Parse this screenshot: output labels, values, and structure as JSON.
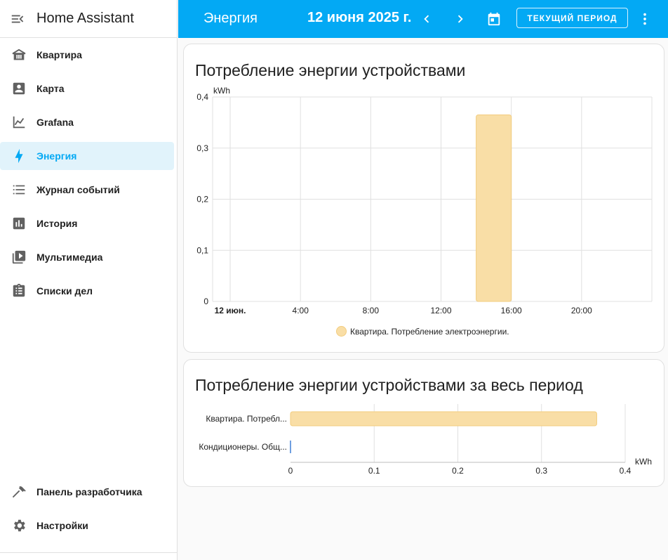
{
  "sidebar": {
    "title": "Home Assistant",
    "items": [
      {
        "label": "Квартира",
        "icon": "home-icon",
        "active": false
      },
      {
        "label": "Карта",
        "icon": "account-box-icon",
        "active": false
      },
      {
        "label": "Grafana",
        "icon": "chart-line-icon",
        "active": false
      },
      {
        "label": "Энергия",
        "icon": "lightning-bolt-icon",
        "active": true
      },
      {
        "label": "Журнал событий",
        "icon": "format-list-icon",
        "active": false
      },
      {
        "label": "История",
        "icon": "chart-box-icon",
        "active": false
      },
      {
        "label": "Мультимедиа",
        "icon": "play-box-multiple-icon",
        "active": false
      },
      {
        "label": "Списки дел",
        "icon": "clipboard-list-icon",
        "active": false
      }
    ],
    "bottom_items": [
      {
        "label": "Панель разработчика",
        "icon": "hammer-icon"
      },
      {
        "label": "Настройки",
        "icon": "cog-icon"
      }
    ]
  },
  "topbar": {
    "title": "Энергия",
    "date": "12 июня 2025 г.",
    "period_button": "ТЕКУЩИЙ ПЕРИОД",
    "icons": [
      "chevron-left-icon",
      "chevron-right-icon",
      "calendar-icon",
      "dots-vertical-icon"
    ]
  },
  "colors": {
    "accent": "#03a9f4",
    "bar_fill": "#f9dea6",
    "bar_stroke": "#f2cc7e",
    "sidebar_active_bg": "#e1f3fb"
  },
  "cards": {
    "hourly_title": "Потребление энергии устройствами",
    "total_title": "Потребление энергии устройствами за весь период"
  },
  "chart_data": [
    {
      "type": "bar",
      "title": "Потребление энергии устройствами",
      "unit": "kWh",
      "x_ticks": [
        "12 июн.",
        "4:00",
        "8:00",
        "12:00",
        "16:00",
        "20:00"
      ],
      "y_ticks": [
        "0",
        "0,1",
        "0,2",
        "0,3",
        "0,4"
      ],
      "ylim": [
        0,
        0.4
      ],
      "xlim_hours": [
        -1,
        24
      ],
      "series": [
        {
          "name": "Квартира. Потребление электроэнергии.",
          "x_start_hour": 14,
          "x_end_hour": 16,
          "value": 0.365
        }
      ],
      "legend": "bottom-center",
      "grid": true
    },
    {
      "type": "bar",
      "orientation": "horizontal",
      "title": "Потребление энергии устройствами за весь период",
      "unit": "kWh",
      "categories": [
        "Квартира. Потребл...",
        "Кондиционеры. Общ..."
      ],
      "values": [
        0.366,
        0.0
      ],
      "x_ticks": [
        "0",
        "0.1",
        "0.2",
        "0.3",
        "0.4"
      ],
      "xlim": [
        0,
        0.4
      ],
      "grid": true
    }
  ]
}
